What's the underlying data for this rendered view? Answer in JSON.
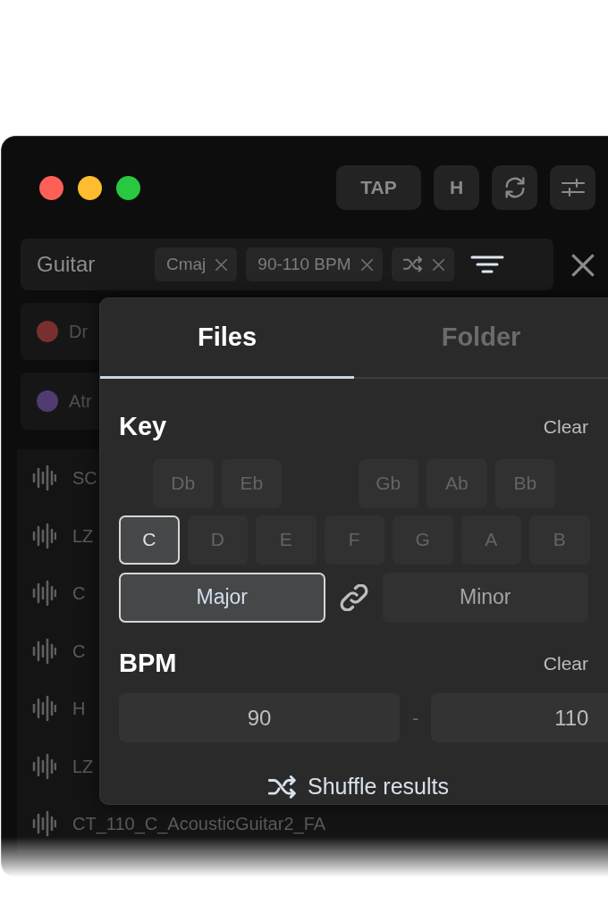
{
  "toolbar": {
    "buttons": [
      {
        "kind": "text",
        "label": "TAP"
      },
      {
        "kind": "text",
        "label": "H"
      },
      {
        "kind": "refresh"
      },
      {
        "kind": "sliders"
      }
    ]
  },
  "search": {
    "value": "Guitar",
    "chips": [
      {
        "kind": "text",
        "label": "Cmaj"
      },
      {
        "kind": "text",
        "label": "90-110 BPM"
      },
      {
        "kind": "shuffle"
      }
    ]
  },
  "tags": [
    {
      "label": "Dr",
      "color": "#7a2f2f"
    },
    {
      "label": "Atr",
      "color": "#4f3b70"
    }
  ],
  "files": [
    {
      "name": "SC"
    },
    {
      "name": "LZ"
    },
    {
      "name": "C"
    },
    {
      "name": "C"
    },
    {
      "name": "H"
    },
    {
      "name": "LZ"
    },
    {
      "name": "CT_110_C_AcousticGuitar2_FA"
    }
  ],
  "popover": {
    "tabs": [
      {
        "label": "Files",
        "selected": true
      },
      {
        "label": "Folder",
        "selected": false
      }
    ],
    "key": {
      "title": "Key",
      "clear": "Clear",
      "sharps": [
        {
          "label": "Db",
          "selected": false
        },
        {
          "label": "Eb",
          "selected": false
        },
        {
          "label": "Gb",
          "selected": false
        },
        {
          "label": "Ab",
          "selected": false
        },
        {
          "label": "Bb",
          "selected": false
        }
      ],
      "naturals": [
        {
          "label": "C",
          "selected": true
        },
        {
          "label": "D",
          "selected": false
        },
        {
          "label": "E",
          "selected": false
        },
        {
          "label": "F",
          "selected": false
        },
        {
          "label": "G",
          "selected": false
        },
        {
          "label": "A",
          "selected": false
        },
        {
          "label": "B",
          "selected": false
        }
      ],
      "modes": [
        {
          "label": "Major",
          "selected": true
        },
        {
          "label": "Minor",
          "selected": false
        }
      ]
    },
    "bpm": {
      "title": "BPM",
      "clear": "Clear",
      "min": "90",
      "separator": "-",
      "max": "110"
    },
    "shuffle": "Shuffle results"
  }
}
